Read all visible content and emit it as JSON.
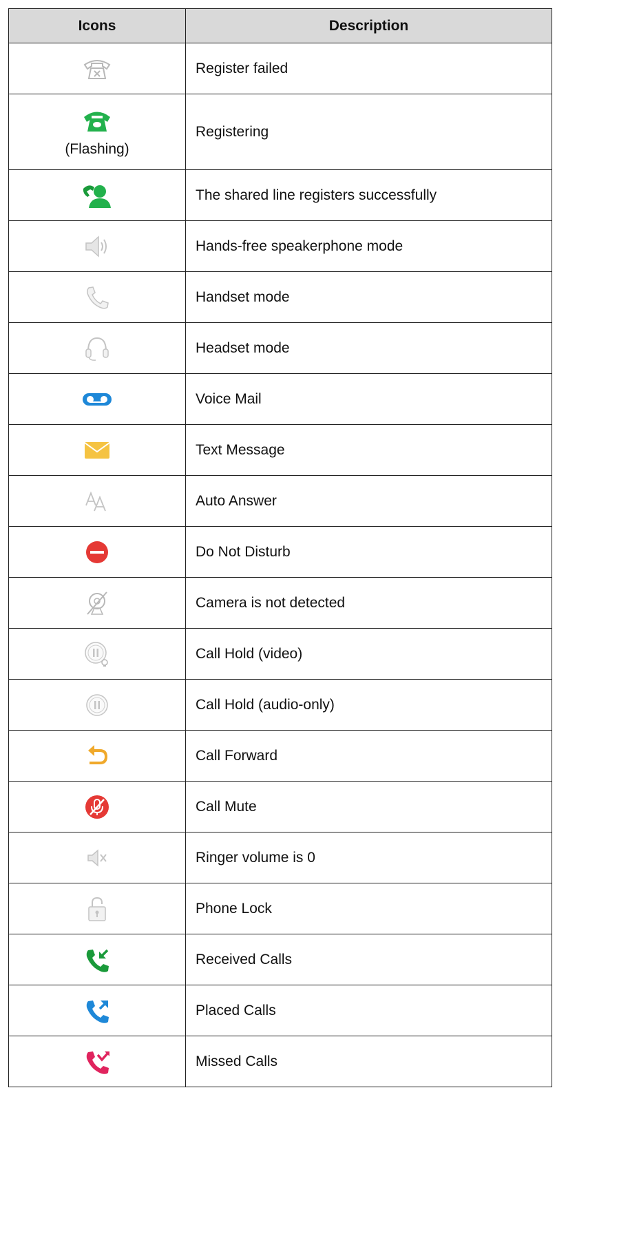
{
  "table": {
    "headers": {
      "icons": "Icons",
      "description": "Description"
    },
    "rows": [
      {
        "icon": "register-failed-icon",
        "note": "",
        "description": "Register failed"
      },
      {
        "icon": "registering-icon",
        "note": "(Flashing)",
        "description": "Registering"
      },
      {
        "icon": "shared-line-icon",
        "note": "",
        "description": "The shared line registers successfully"
      },
      {
        "icon": "speakerphone-icon",
        "note": "",
        "description": "Hands-free speakerphone mode"
      },
      {
        "icon": "handset-icon",
        "note": "",
        "description": "Handset mode"
      },
      {
        "icon": "headset-icon",
        "note": "",
        "description": "Headset mode"
      },
      {
        "icon": "voice-mail-icon",
        "note": "",
        "description": "Voice Mail"
      },
      {
        "icon": "text-message-icon",
        "note": "",
        "description": "Text Message"
      },
      {
        "icon": "auto-answer-icon",
        "note": "",
        "description": "Auto Answer"
      },
      {
        "icon": "do-not-disturb-icon",
        "note": "",
        "description": "Do Not Disturb"
      },
      {
        "icon": "camera-not-detected-icon",
        "note": "",
        "description": "Camera is not detected"
      },
      {
        "icon": "call-hold-video-icon",
        "note": "",
        "description": "Call Hold (video)"
      },
      {
        "icon": "call-hold-audio-icon",
        "note": "",
        "description": "Call Hold (audio-only)"
      },
      {
        "icon": "call-forward-icon",
        "note": "",
        "description": "Call Forward"
      },
      {
        "icon": "call-mute-icon",
        "note": "",
        "description": "Call Mute"
      },
      {
        "icon": "ringer-volume-zero-icon",
        "note": "",
        "description": "Ringer volume is 0"
      },
      {
        "icon": "phone-lock-icon",
        "note": "",
        "description": "Phone Lock"
      },
      {
        "icon": "received-calls-icon",
        "note": "",
        "description": "Received Calls"
      },
      {
        "icon": "placed-calls-icon",
        "note": "",
        "description": "Placed Calls"
      },
      {
        "icon": "missed-calls-icon",
        "note": "",
        "description": "Missed Calls"
      }
    ]
  },
  "colors": {
    "header_bg": "#d9d9d9",
    "green": "#22b14c",
    "dark_green": "#1a9a3a",
    "blue": "#1e88d8",
    "yellow": "#f5c342",
    "orange": "#f0a92b",
    "red": "#e53935",
    "gray": "#b8b8b8"
  }
}
